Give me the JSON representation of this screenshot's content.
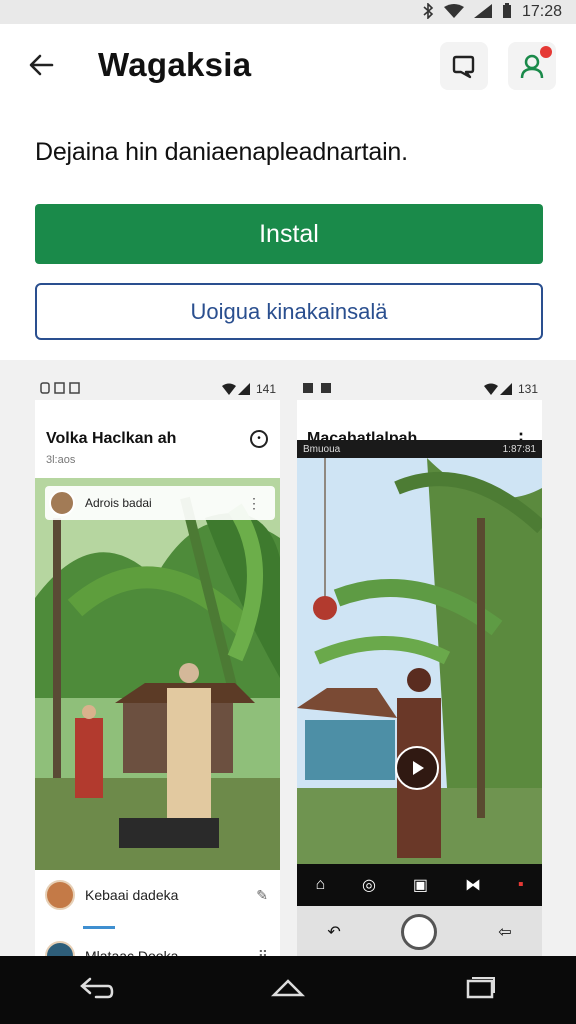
{
  "status_bar": {
    "time": "17:28"
  },
  "app_bar": {
    "title": "Wagaksia"
  },
  "description": "Dejaina hin daniaenapleadnartain.",
  "buttons": {
    "install": "Instal",
    "secondary": "Uoigua kinakainsalä"
  },
  "screenshot1": {
    "status_text": "141",
    "title": "Volka Haclkan ah",
    "subtitle": "3l:aos",
    "card_label": "Adrois badai",
    "row1_label": "Kebaai dadeka",
    "row2_label": "Mlataac Dooka"
  },
  "screenshot2": {
    "status_text": "131",
    "title": "Macahatlalpah",
    "bar_left": "Bmuoua",
    "bar_right": "1:87:81"
  },
  "colors": {
    "install_bg": "#1a8a4a",
    "secondary_border": "#2a4f8f",
    "notification": "#e53935"
  }
}
